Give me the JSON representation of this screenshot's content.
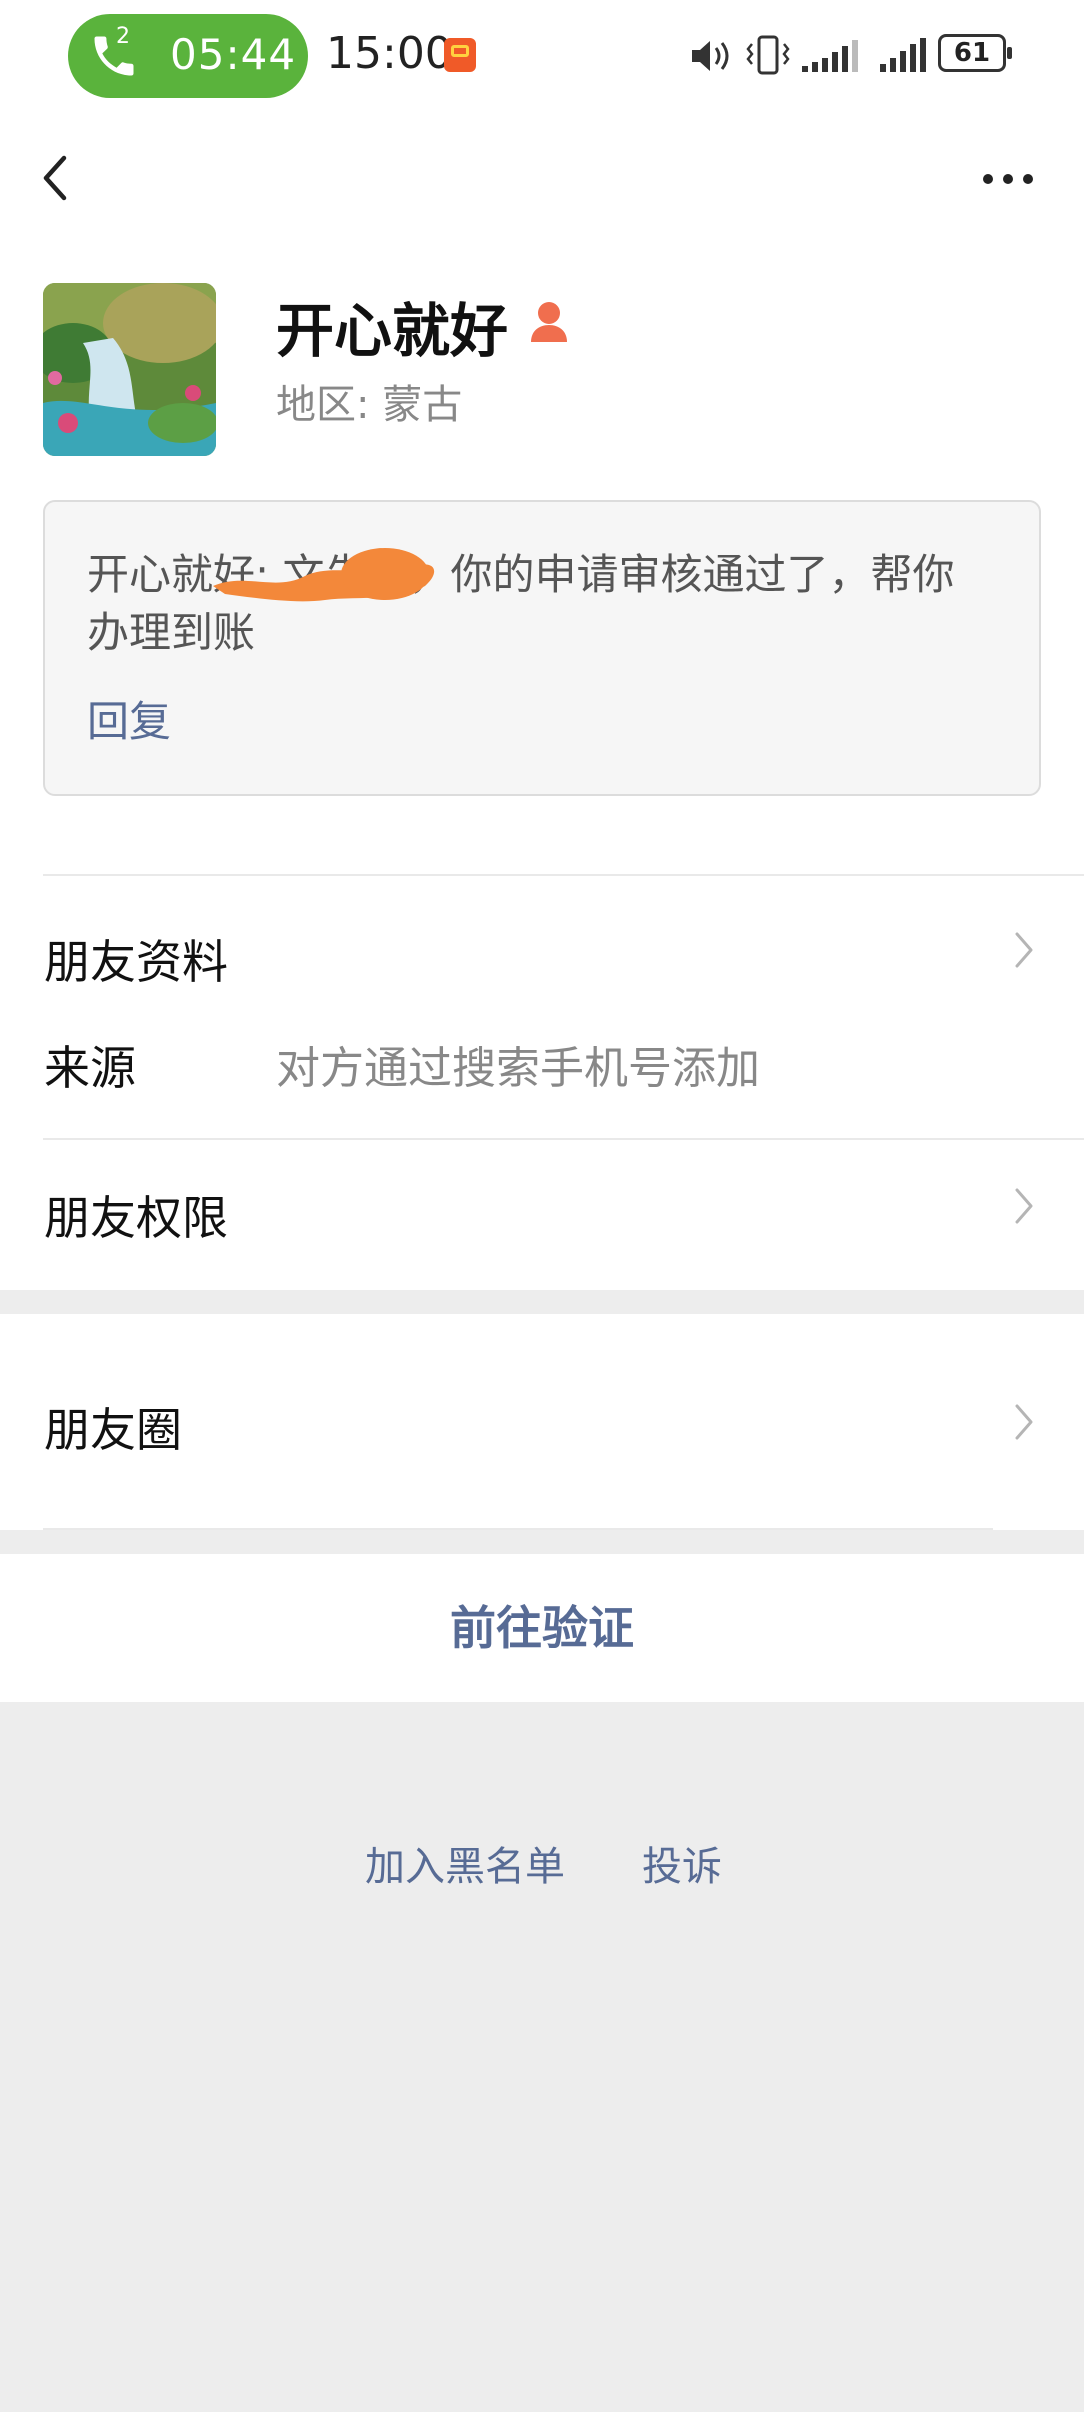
{
  "status_bar": {
    "call_timer": "05:44",
    "call_badge": "2",
    "clock": "15:00",
    "battery": "61"
  },
  "profile": {
    "nickname": "开心就好",
    "region": "地区: 蒙古",
    "message": "开心就好:            文先生，你的申请审核通过了，帮你办理到账",
    "reply_label": "回复"
  },
  "rows": {
    "friend_profile": "朋友资料",
    "source_label": "来源",
    "source_value": "对方通过搜索手机号添加",
    "friend_permissions": "朋友权限",
    "moments": "朋友圈"
  },
  "actions": {
    "verify": "前往验证",
    "blacklist": "加入黑名单",
    "report": "投诉"
  },
  "colors": {
    "link": "#576b95",
    "call_pill": "#5ab33c",
    "background": "#ededed"
  }
}
